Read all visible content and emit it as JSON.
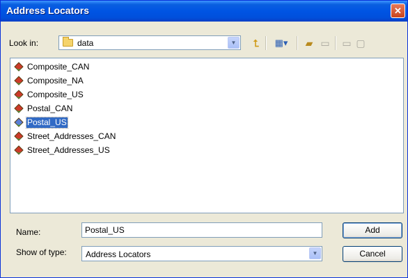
{
  "window": {
    "title": "Address Locators",
    "close_symbol": "✕"
  },
  "lookin": {
    "label": "Look in:",
    "value": "data"
  },
  "toolbar": {
    "icons": [
      "up-one-level-icon",
      "views-menu-icon",
      "new-folder-icon",
      "disabled-icon",
      "disabled-icon"
    ]
  },
  "files": [
    {
      "label": "Composite_CAN",
      "selected": false
    },
    {
      "label": "Composite_NA",
      "selected": false
    },
    {
      "label": "Composite_US",
      "selected": false
    },
    {
      "label": "Postal_CAN",
      "selected": false
    },
    {
      "label": "Postal_US",
      "selected": true
    },
    {
      "label": "Street_Addresses_CAN",
      "selected": false
    },
    {
      "label": "Street_Addresses_US",
      "selected": false
    }
  ],
  "name": {
    "label": "Name:",
    "value": "Postal_US"
  },
  "type": {
    "label": "Show of type:",
    "value": "Address Locators"
  },
  "buttons": {
    "add": "Add",
    "cancel": "Cancel"
  },
  "colors": {
    "title_bar": "#0054e3",
    "selection": "#316ac5",
    "dialog_bg": "#ece9d8"
  }
}
